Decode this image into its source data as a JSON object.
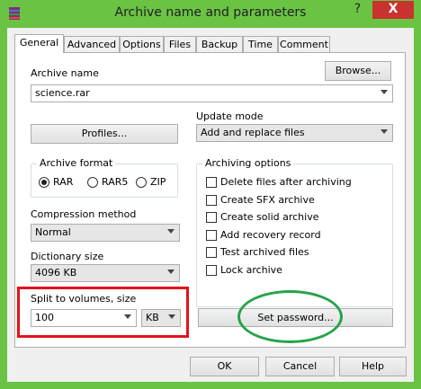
{
  "window": {
    "title": "Archive name and parameters",
    "help_glyph": "?",
    "close_glyph": "X"
  },
  "tabs": [
    {
      "label": "General"
    },
    {
      "label": "Advanced"
    },
    {
      "label": "Options"
    },
    {
      "label": "Files"
    },
    {
      "label": "Backup"
    },
    {
      "label": "Time"
    },
    {
      "label": "Comment"
    }
  ],
  "archive_name": {
    "label": "Archive name",
    "value": "science.rar",
    "browse_label": "Browse..."
  },
  "profiles_label": "Profiles...",
  "update_mode": {
    "label": "Update mode",
    "value": "Add and replace files"
  },
  "archive_format": {
    "label": "Archive format",
    "options": [
      "RAR",
      "RAR5",
      "ZIP"
    ],
    "selected": "RAR"
  },
  "compression": {
    "label": "Compression method",
    "value": "Normal"
  },
  "dictionary": {
    "label": "Dictionary size",
    "value": "4096 KB"
  },
  "split": {
    "label": "Split to volumes, size",
    "value": "100",
    "unit": "KB"
  },
  "archiving_options": {
    "label": "Archiving options",
    "items": [
      {
        "label": "Delete files after archiving",
        "checked": false
      },
      {
        "label": "Create SFX archive",
        "checked": false
      },
      {
        "label": "Create solid archive",
        "checked": false
      },
      {
        "label": "Add recovery record",
        "checked": false
      },
      {
        "label": "Test archived files",
        "checked": false
      },
      {
        "label": "Lock archive",
        "checked": false
      }
    ]
  },
  "set_password_label": "Set password...",
  "footer": {
    "ok_label": "OK",
    "cancel_label": "Cancel",
    "help_label": "Help"
  },
  "annotations": {
    "red_box_color": "#e3121c",
    "green_ellipse_color": "#26a34a"
  }
}
